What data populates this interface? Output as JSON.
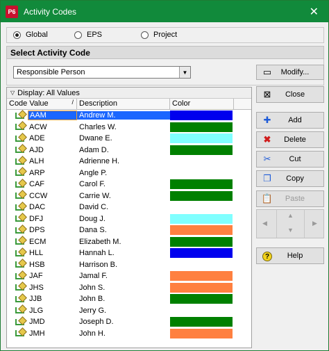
{
  "window": {
    "title": "Activity Codes",
    "app_badge": "P6"
  },
  "scope": {
    "options": [
      {
        "label": "Global",
        "selected": true
      },
      {
        "label": "EPS",
        "selected": false
      },
      {
        "label": "Project",
        "selected": false
      }
    ]
  },
  "select_section": {
    "title": "Select Activity Code",
    "combo_value": "Responsible Person"
  },
  "buttons": {
    "modify": "Modify...",
    "close": "Close",
    "add": "Add",
    "delete": "Delete",
    "cut": "Cut",
    "copy": "Copy",
    "paste": "Paste",
    "help": "Help"
  },
  "grid": {
    "display_label": "Display: All Values",
    "columns": {
      "code": "Code Value",
      "description": "Description",
      "color": "Color"
    },
    "rows": [
      {
        "code": "AAM",
        "description": "Andrew M.",
        "color": "#0000ee",
        "selected": true
      },
      {
        "code": "ACW",
        "description": "Charles W.",
        "color": "#008000"
      },
      {
        "code": "ADE",
        "description": "Dwane E.",
        "color": "#80ffff"
      },
      {
        "code": "AJD",
        "description": "Adam D.",
        "color": "#008000"
      },
      {
        "code": "ALH",
        "description": "Adrienne H.",
        "color": ""
      },
      {
        "code": "ARP",
        "description": "Angle P.",
        "color": ""
      },
      {
        "code": "CAF",
        "description": "Carol F.",
        "color": "#008000"
      },
      {
        "code": "CCW",
        "description": "Carrie W.",
        "color": "#008000"
      },
      {
        "code": "DAC",
        "description": "David C.",
        "color": ""
      },
      {
        "code": "DFJ",
        "description": "Doug J.",
        "color": "#80ffff"
      },
      {
        "code": "DPS",
        "description": "Dana S.",
        "color": "#ff8040"
      },
      {
        "code": "ECM",
        "description": "Elizabeth M.",
        "color": "#008000"
      },
      {
        "code": "HLL",
        "description": "Hannah L.",
        "color": "#0000ee"
      },
      {
        "code": "HSB",
        "description": "Harrison B.",
        "color": ""
      },
      {
        "code": "JAF",
        "description": "Jamal F.",
        "color": "#ff8040"
      },
      {
        "code": "JHS",
        "description": "John S.",
        "color": "#ff8040"
      },
      {
        "code": "JJB",
        "description": "John B.",
        "color": "#008000"
      },
      {
        "code": "JLG",
        "description": "Jerry G.",
        "color": ""
      },
      {
        "code": "JMD",
        "description": "Joseph D.",
        "color": "#008000"
      },
      {
        "code": "JMH",
        "description": "John H.",
        "color": "#ff8040"
      }
    ]
  }
}
